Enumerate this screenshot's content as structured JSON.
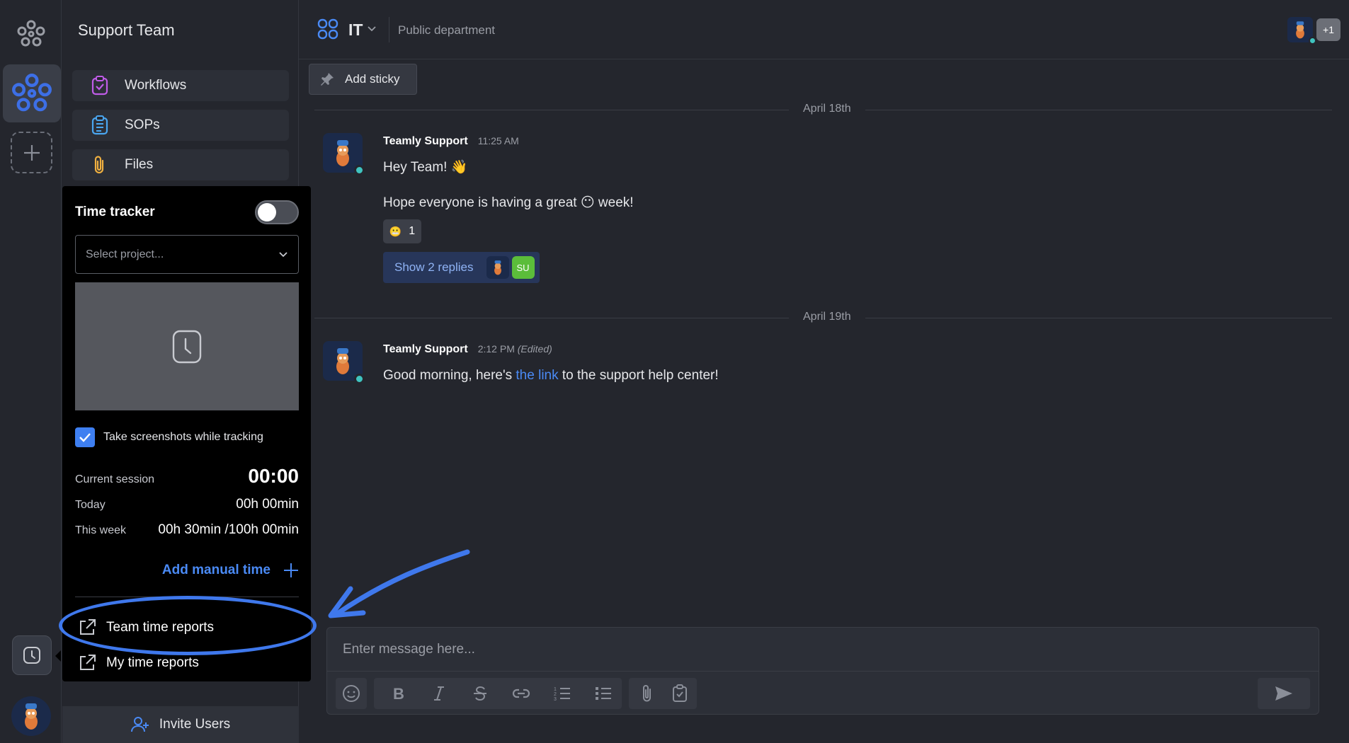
{
  "sidebar": {
    "team_name": "Support Team",
    "items": [
      {
        "label": "Workflows",
        "icon": "checklist-clipboard-icon",
        "color": "#c05ce8"
      },
      {
        "label": "SOPs",
        "icon": "list-clipboard-icon",
        "color": "#4aa6f0"
      },
      {
        "label": "Files",
        "icon": "paperclip-icon",
        "color": "#f0b040"
      }
    ],
    "invite_label": "Invite Users"
  },
  "time_tracker": {
    "title": "Time tracker",
    "toggle_on": false,
    "project_placeholder": "Select project...",
    "screenshot_checkbox_label": "Take screenshots while tracking",
    "screenshot_checked": true,
    "current_session_label": "Current session",
    "current_session_value": "00:00",
    "today_label": "Today",
    "today_value": "00h 00min",
    "week_label": "This week",
    "week_value": "00h 30min /100h 00min",
    "add_manual_label": "Add manual time",
    "team_reports_label": "Team time reports",
    "my_reports_label": "My time reports"
  },
  "header": {
    "channel_name": "IT",
    "channel_desc": "Public department",
    "extra_members": "+1"
  },
  "toolbar": {
    "add_sticky_label": "Add sticky"
  },
  "messages": {
    "day1": "April 18th",
    "day2": "April 19th",
    "m1": {
      "author": "Teamly Support",
      "time": "11:25 AM",
      "line1": "Hey Team! 👋",
      "line2": "Hope everyone is having a great 😶 week!",
      "reaction_emoji": "😬",
      "reaction_count": "1",
      "replies_label": "Show 2 replies",
      "reply_initials": "SU"
    },
    "m2": {
      "author": "Teamly Support",
      "time": "2:12 PM",
      "edited": "(Edited)",
      "text_before": "Good morning, here's ",
      "link_text": "the link",
      "text_after": " to the support help center!"
    }
  },
  "composer": {
    "placeholder": "Enter message here..."
  },
  "colors": {
    "accent": "#4a8af5",
    "annotation": "#3f78ec",
    "online": "#3fc4c0"
  }
}
